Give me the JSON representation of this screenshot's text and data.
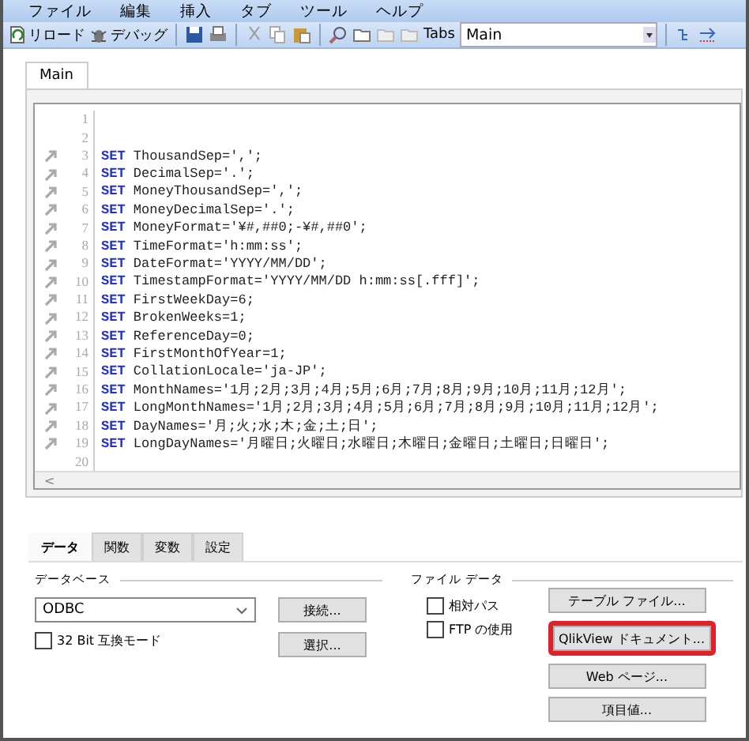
{
  "menu": [
    "ファイル",
    "編集",
    "挿入",
    "タブ",
    "ツール",
    "ヘルプ"
  ],
  "toolbar": {
    "reload": "リロード",
    "debug": "デバッグ",
    "tabs_label": "Tabs",
    "tabs_value": "Main"
  },
  "script_tabs": [
    {
      "label": "Main",
      "selected": true
    }
  ],
  "editor": {
    "lines": [
      {
        "number": "1",
        "marker": false
      },
      {
        "number": "2",
        "marker": false
      },
      {
        "number": "3",
        "marker": true,
        "keyword": "SET",
        "text": "ThousandSep=',';"
      },
      {
        "number": "4",
        "marker": true,
        "keyword": "SET",
        "text": "DecimalSep='.';"
      },
      {
        "number": "5",
        "marker": true,
        "keyword": "SET",
        "text": "MoneyThousandSep=',';"
      },
      {
        "number": "6",
        "marker": true,
        "keyword": "SET",
        "text": "MoneyDecimalSep='.';"
      },
      {
        "number": "7",
        "marker": true,
        "keyword": "SET",
        "text": "MoneyFormat='¥#,##0;-¥#,##0';"
      },
      {
        "number": "8",
        "marker": true,
        "keyword": "SET",
        "text": "TimeFormat='h:mm:ss';"
      },
      {
        "number": "9",
        "marker": true,
        "keyword": "SET",
        "text": "DateFormat='YYYY/MM/DD';"
      },
      {
        "number": "10",
        "marker": true,
        "keyword": "SET",
        "text": "TimestampFormat='YYYY/MM/DD h:mm:ss[.fff]';"
      },
      {
        "number": "11",
        "marker": true,
        "keyword": "SET",
        "text": "FirstWeekDay=6;"
      },
      {
        "number": "12",
        "marker": true,
        "keyword": "SET",
        "text": "BrokenWeeks=1;"
      },
      {
        "number": "13",
        "marker": true,
        "keyword": "SET",
        "text": "ReferenceDay=0;"
      },
      {
        "number": "14",
        "marker": true,
        "keyword": "SET",
        "text": "FirstMonthOfYear=1;"
      },
      {
        "number": "15",
        "marker": true,
        "keyword": "SET",
        "text": "CollationLocale='ja-JP';"
      },
      {
        "number": "16",
        "marker": true,
        "keyword": "SET",
        "text": "MonthNames='1月;2月;3月;4月;5月;6月;7月;8月;9月;10月;11月;12月';"
      },
      {
        "number": "17",
        "marker": true,
        "keyword": "SET",
        "text": "LongMonthNames='1月;2月;3月;4月;5月;6月;7月;8月;9月;10月;11月;12月';"
      },
      {
        "number": "18",
        "marker": true,
        "keyword": "SET",
        "text": "DayNames='月;火;水;木;金;土;日';"
      },
      {
        "number": "19",
        "marker": true,
        "keyword": "SET",
        "text": "LongDayNames='月曜日;火曜日;水曜日;木曜日;金曜日;土曜日;日曜日';"
      },
      {
        "number": "20",
        "marker": false
      }
    ],
    "scroll_left": "<"
  },
  "bottom_tabs": [
    {
      "label": "データ",
      "selected": true
    },
    {
      "label": "関数",
      "selected": false
    },
    {
      "label": "変数",
      "selected": false
    },
    {
      "label": "設定",
      "selected": false
    }
  ],
  "database": {
    "title": "データベース",
    "select_value": "ODBC",
    "compat": {
      "label": "32 Bit 互換モード",
      "checked": false
    },
    "buttons": [
      "接続...",
      "選択..."
    ]
  },
  "file_data": {
    "title": "ファイル データ",
    "checks": [
      {
        "label": "相対パス",
        "checked": false
      },
      {
        "label": "FTP の使用",
        "checked": false
      }
    ],
    "buttons": [
      {
        "label": "テーブル ファイル...",
        "highlighted": false
      },
      {
        "label": "QlikView ドキュメント...",
        "highlighted": true
      },
      {
        "label": "Web ページ...",
        "highlighted": false
      },
      {
        "label": "項目値...",
        "highlighted": false
      }
    ]
  }
}
